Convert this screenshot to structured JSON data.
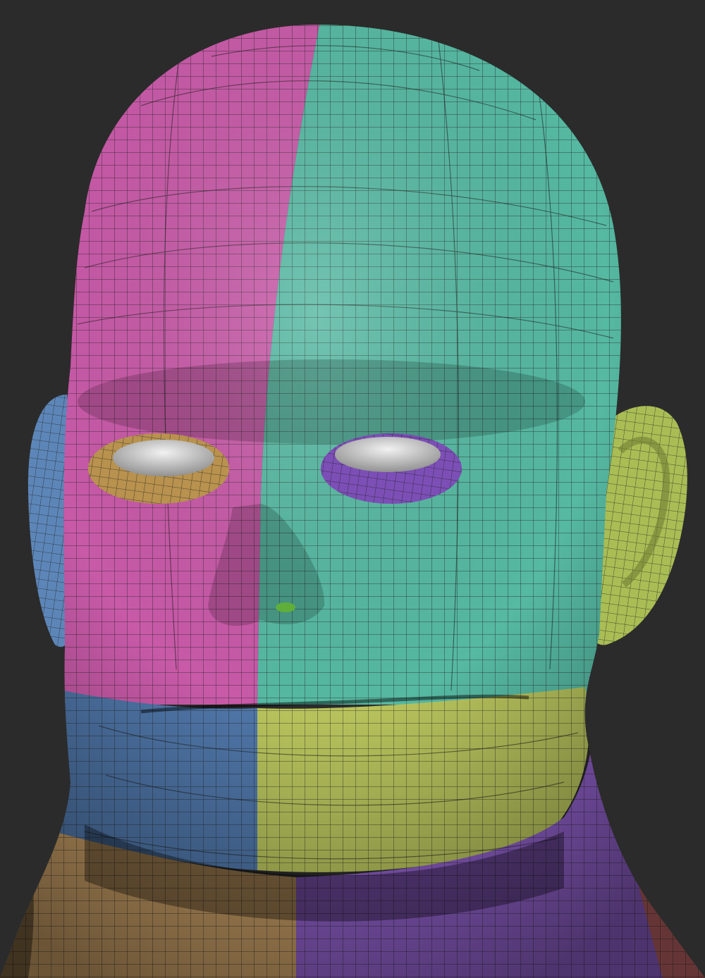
{
  "viewport": {
    "background": "#2b2b2b",
    "subject": "sculpted-head-mesh",
    "shading": "wireframe-over-polygroups",
    "wireframe_color": "#1e1e1e"
  },
  "polygroups": [
    {
      "name": "head-right-upper",
      "color": "#c85aa8"
    },
    {
      "name": "head-left-upper",
      "color": "#56b9a2"
    },
    {
      "name": "lower-face-right",
      "color": "#4f76a8"
    },
    {
      "name": "lower-face-left",
      "color": "#b7c25c"
    },
    {
      "name": "neck-right",
      "color": "#c39a63"
    },
    {
      "name": "neck-left",
      "color": "#8e5fc7"
    },
    {
      "name": "neck-back",
      "color": "#b86060"
    },
    {
      "name": "ear-right",
      "color": "#5d86b8"
    },
    {
      "name": "ear-left",
      "color": "#a9bd55"
    },
    {
      "name": "eyelid-right",
      "color": "#b8924e"
    },
    {
      "name": "eyelid-left",
      "color": "#7c4fb6"
    },
    {
      "name": "eyeball",
      "color": "#cfcfcf"
    }
  ]
}
